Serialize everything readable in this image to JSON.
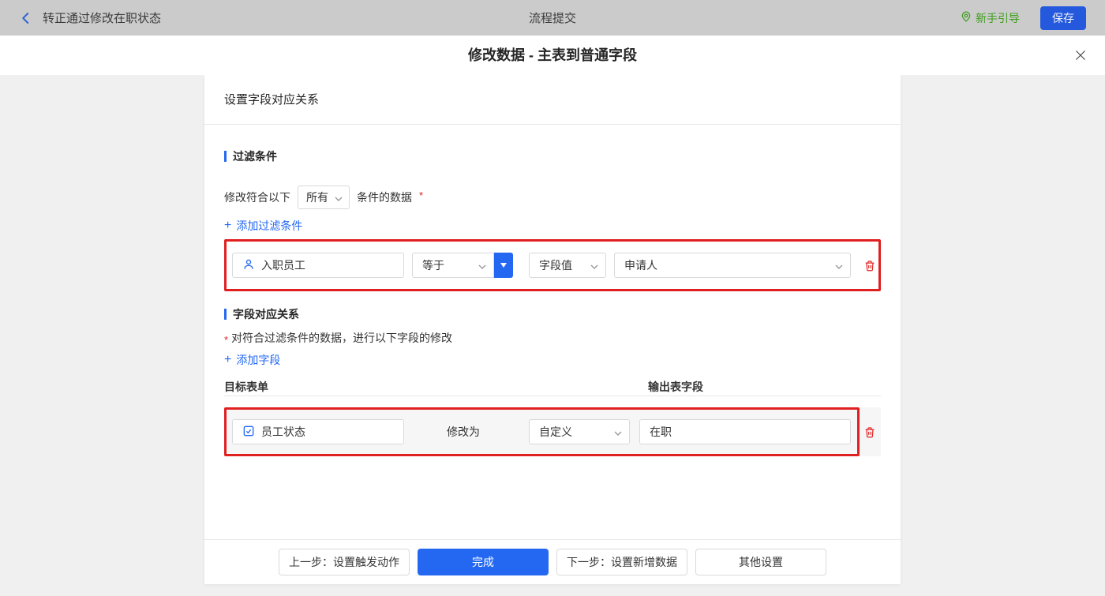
{
  "topbar": {
    "workflow_title": "转正通过修改在职状态",
    "center_title": "流程提交",
    "guide_label": "新手引导",
    "save_label": "保存"
  },
  "dialog": {
    "title": "修改数据 - 主表到普通字段"
  },
  "panel": {
    "header": "设置字段对应关系",
    "filter": {
      "section_title": "过滤条件",
      "prefix": "修改符合以下",
      "match_value": "所有",
      "suffix": "条件的数据",
      "required": "*",
      "add_icon": "+",
      "add_label": "添加过滤条件",
      "row": {
        "field": "入职员工",
        "operator": "等于",
        "value_type": "字段值",
        "value": "申请人"
      }
    },
    "mapping": {
      "section_title": "字段对应关系",
      "required": "*",
      "description": "对符合过滤条件的数据，进行以下字段的修改",
      "add_icon": "+",
      "add_label": "添加字段",
      "col_target": "目标表单",
      "col_output": "输出表字段",
      "row": {
        "field": "员工状态",
        "action_label": "修改为",
        "value_type": "自定义",
        "value": "在职"
      }
    },
    "footer": {
      "prev_label": "上一步：设置触发动作",
      "done_label": "完成",
      "next_label": "下一步：设置新增数据",
      "other_label": "其他设置"
    }
  },
  "colors": {
    "accent_blue": "#2468f2",
    "annotation_red": "#e02020",
    "guide_green": "#3f9e1e"
  }
}
